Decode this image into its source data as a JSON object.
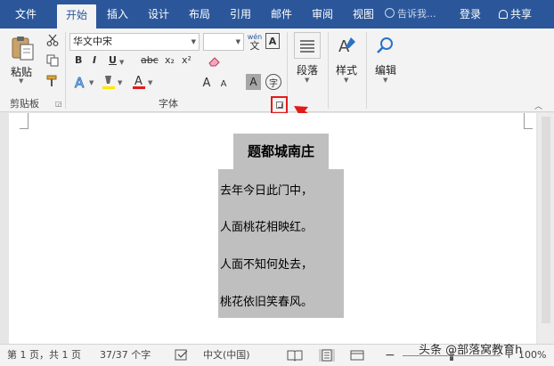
{
  "tabs": {
    "file": "文件",
    "home": "开始",
    "insert": "插入",
    "design": "设计",
    "layout": "布局",
    "references": "引用",
    "mailings": "邮件",
    "review": "审阅",
    "view": "视图",
    "tell_me": "告诉我...",
    "sign_in": "登录",
    "share": "共享"
  },
  "ribbon": {
    "clipboard": {
      "paste": "粘贴",
      "label": "剪贴板"
    },
    "font": {
      "name": "华文中宋",
      "size": "",
      "label": "字体",
      "wen_small": "wén",
      "wen_big": "文",
      "bold": "B",
      "italic": "I",
      "underline": "U",
      "strike": "abc",
      "subscript": "x₂",
      "superscript": "x²",
      "grow": "A",
      "shrink": "A",
      "char_shade": "A",
      "enclose": "字"
    },
    "paragraph": {
      "label": "段落"
    },
    "styles": {
      "label": "样式"
    },
    "editing": {
      "label": "编辑"
    }
  },
  "document": {
    "title": "题都城南庄",
    "lines": [
      "去年今日此门中，",
      "人面桃花相映红。",
      "人面不知何处去，",
      "桃花依旧笑春风。"
    ]
  },
  "status": {
    "page": "第 1 页，共 1 页",
    "words": "37/37 个字",
    "language": "中文(中国)",
    "zoom": "100%"
  },
  "watermark": "头条 @部落窝教育h",
  "colors": {
    "accent": "#2b579a",
    "highlight": "#bfbfbf",
    "callout": "#e21b1b"
  }
}
